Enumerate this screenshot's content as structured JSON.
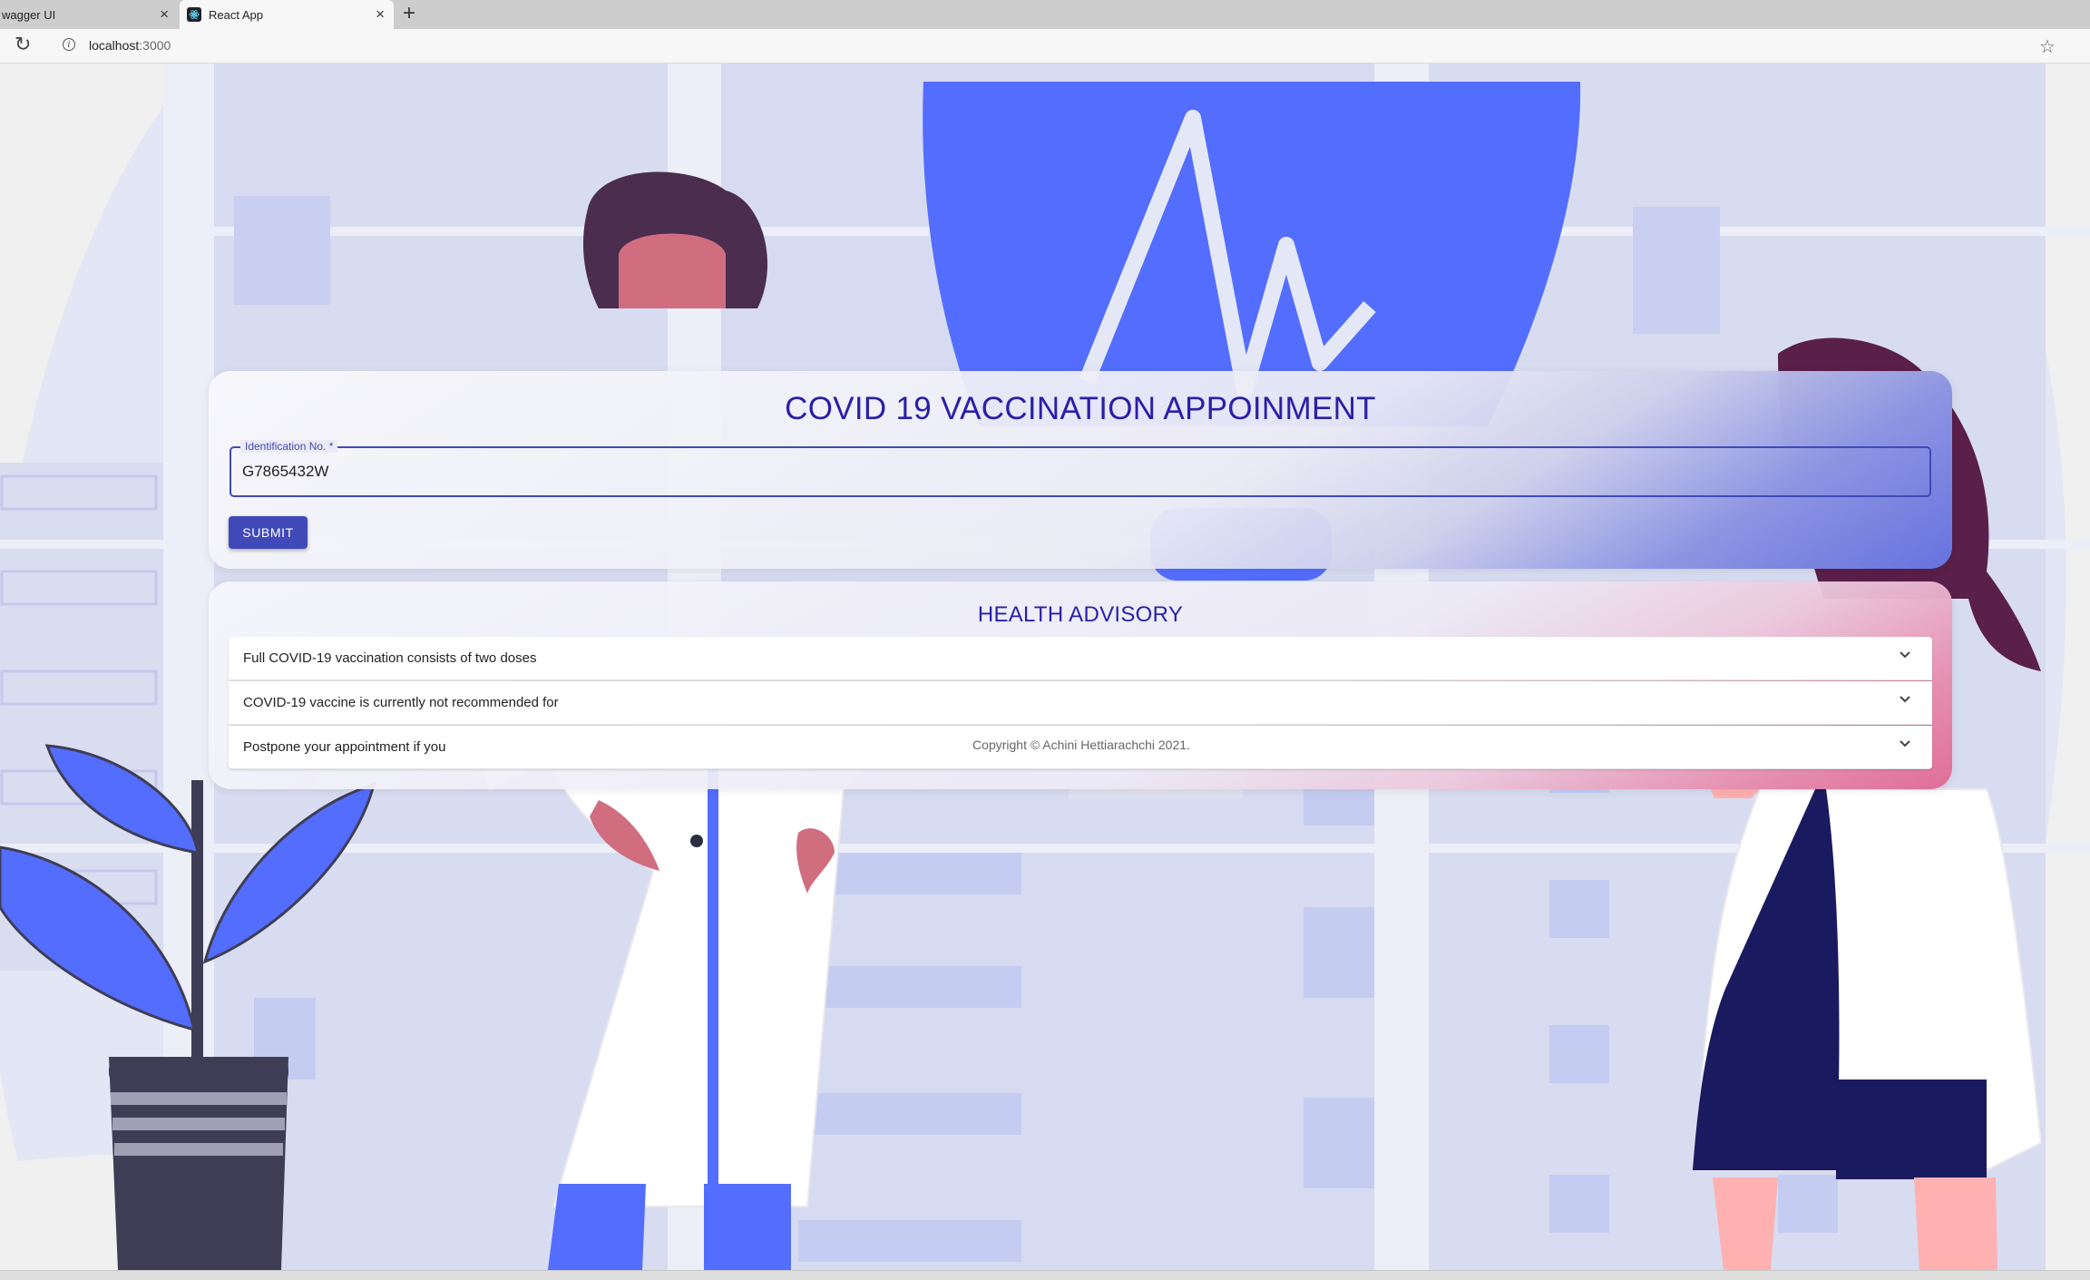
{
  "browser": {
    "tabs": [
      {
        "title": "wagger UI",
        "active": false
      },
      {
        "title": "React App",
        "active": true
      }
    ],
    "address": {
      "host": "localhost",
      "port": ":3000"
    }
  },
  "appointment": {
    "title": "COVID 19 VACCINATION APPOINMENT",
    "id_label": "Identification No. *",
    "id_value": "G7865432W",
    "submit_label": "SUBMIT"
  },
  "advisory": {
    "title": "HEALTH ADVISORY",
    "items": [
      {
        "label": "Full COVID-19 vaccination consists of two doses"
      },
      {
        "label": "COVID-19 vaccine is currently not recommended for"
      },
      {
        "label": "Postpone your appointment if you"
      }
    ]
  },
  "footer": {
    "copyright": "Copyright © Achini Hettiarachchi 2021."
  },
  "colors": {
    "primary": "#3f4ab8",
    "title": "#2a1fa8",
    "illustration_blue": "#536dfe",
    "illustration_light": "#dde0f1"
  }
}
